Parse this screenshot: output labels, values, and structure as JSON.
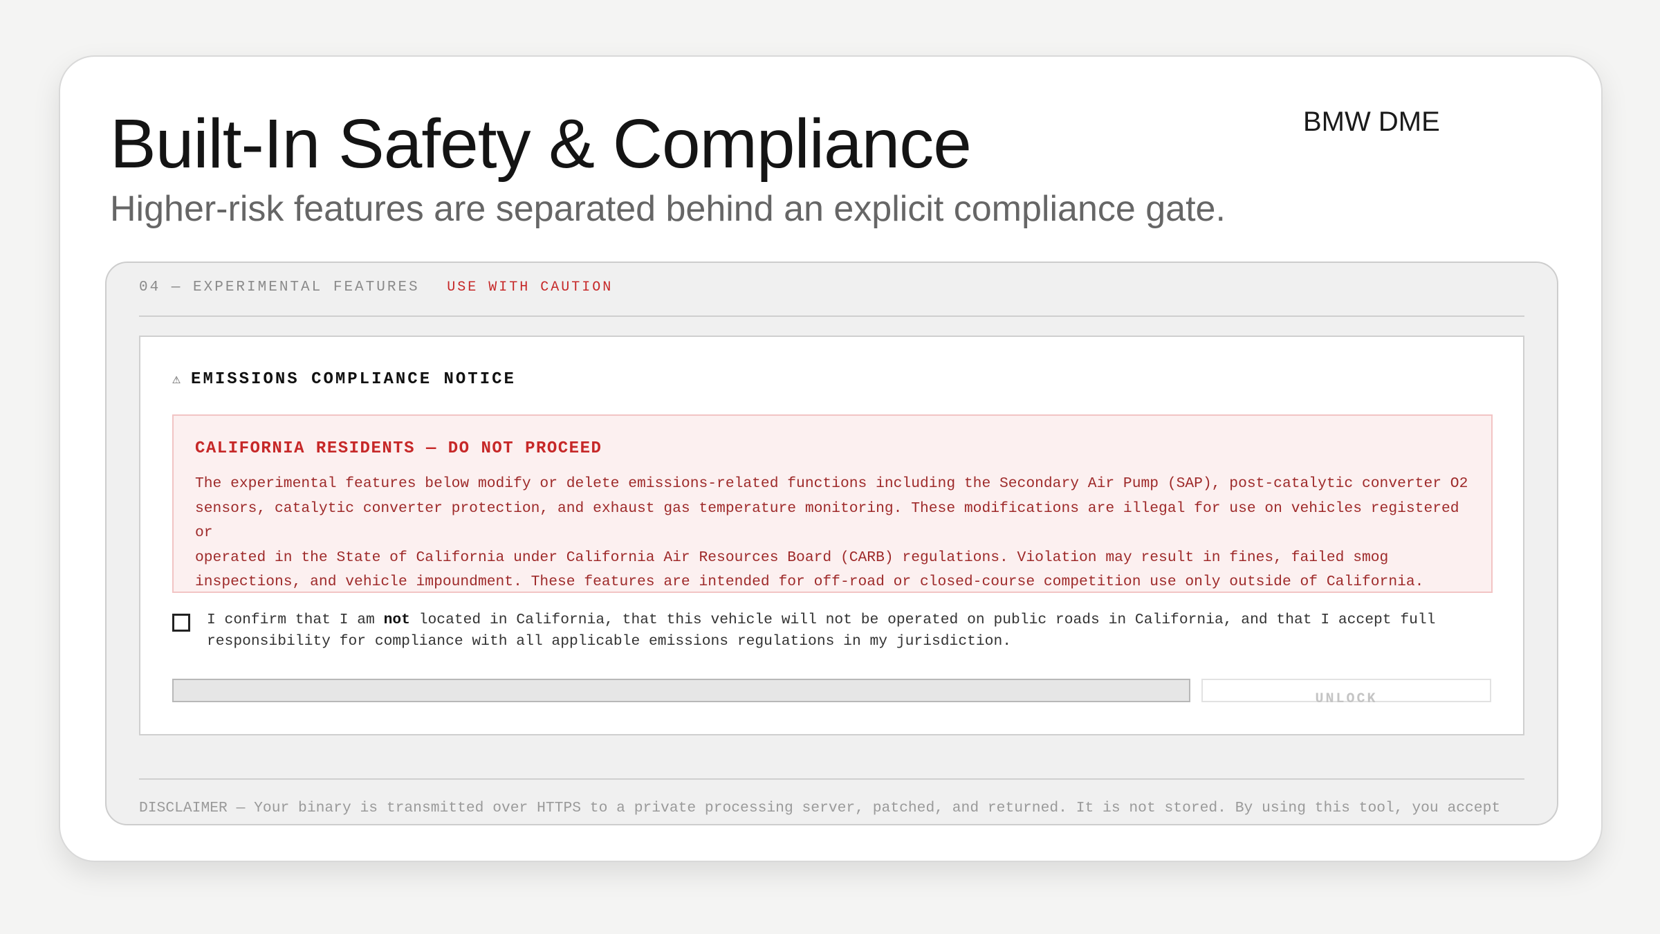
{
  "slide": {
    "title": "Built-In Safety & Compliance",
    "subtitle": "Higher-risk features are separated behind an explicit compliance gate.",
    "brand": "BMW DME"
  },
  "section": {
    "label": "04 — EXPERIMENTAL FEATURES",
    "caution": "USE WITH CAUTION"
  },
  "notice": {
    "warning_glyph": "⚠",
    "title": "EMISSIONS COMPLIANCE NOTICE",
    "alert_title": "CALIFORNIA RESIDENTS — DO NOT PROCEED",
    "alert_body": "The experimental features below modify or delete emissions-related functions including the Secondary Air Pump (SAP), post-catalytic converter O2\nsensors, catalytic converter protection, and exhaust gas temperature monitoring. These modifications are illegal for use on vehicles registered or\noperated in the State of California under California Air Resources Board (CARB) regulations. Violation may result in fines, failed smog\ninspections, and vehicle impoundment. These features are intended for off-road or closed-course competition use only outside of California.",
    "confirm_prefix": "I confirm that I am ",
    "confirm_bold": "not",
    "confirm_suffix": " located in California, that this vehicle will not be operated on public roads in California, and that I accept full\nresponsibility for compliance with all applicable emissions regulations in my jurisdiction.",
    "confirm_checked": false,
    "progress": 0,
    "unlock_label": "UNLOCK"
  },
  "disclaimer": "DISCLAIMER — Your binary is transmitted over HTTPS to a private processing server, patched, and returned. It is not stored. By using this tool, you accept",
  "colors": {
    "caution_red": "#c62828",
    "alert_bg": "#fcf0f0",
    "alert_border": "#f2c4c4",
    "panel_bg": "#f0f0f0"
  }
}
